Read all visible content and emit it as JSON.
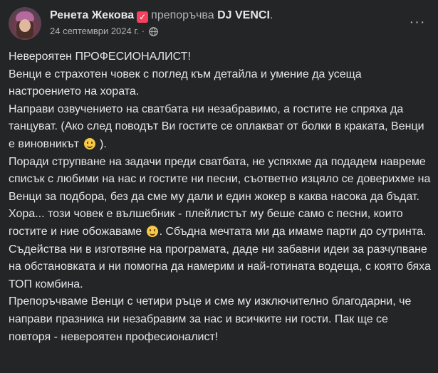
{
  "post": {
    "author_name": "Ренета Жекова",
    "badge_icon": "recommend-badge-icon",
    "action": "препоръчва",
    "page_name": "DJ VENCI",
    "trailing_dot": ".",
    "date": "24 септември 2024 г.",
    "separator": "·",
    "privacy_icon": "globe-icon",
    "more_icon": "more-options-icon",
    "more_glyph": "···"
  },
  "content": {
    "p1": "Невероятен ПРОФЕСИОНАЛИСТ!",
    "p2": "Венци е страхотен човек с поглед към детайла и умение да усеща настроението на хората.",
    "p3_before_emoji": "Направи озвучението на сватбата ни незабравимо, а гостите не спряха да танцуват. (Ако след поводът Ви гостите се оплакват от болки в краката, Венци е виновникът",
    "p3_after_emoji": " ).",
    "p4_before_emoji": "Поради струпване на задачи преди сватбата, не успяхме да подадем навреме списък с любими на нас и гостите ни песни, съответно изцяло се доверихме на Венци за подбора, без да сме му дали и един жокер в каква насока да бъдат. Хора... този човек е вълшебник - плейлистът му беше само с песни, които гостите и ние обожаваме",
    "p4_after_emoji": ". Сбъдна мечтата ми да имаме парти до сутринта.",
    "p5": "Съдейства ни в изготвяне на програмата, даде ни забавни идеи за разчупване на обстановката и ни помогна да намерим и най-готината водеща, с която бяха ТОП комбина.",
    "p6": "Препоръчваме Венци с четири ръце и сме му изключително благодарни, че направи празника ни незабравим за нас и всичките ни гости. Пак ще се повторя - невероятен професионалист!",
    "emoji_icon": "smiley-emoji-icon"
  },
  "colors": {
    "background": "#242526",
    "primary_text": "#e4e6eb",
    "secondary_text": "#b0b3b8",
    "badge": "#f3425f"
  }
}
